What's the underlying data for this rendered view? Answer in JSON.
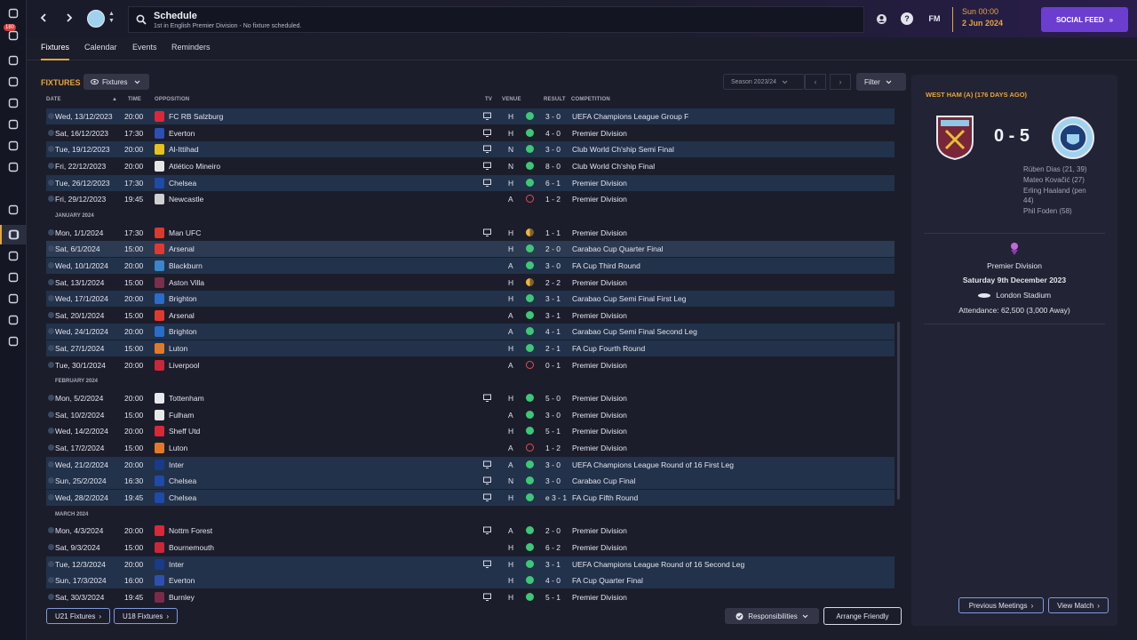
{
  "rail": {
    "badge": "180",
    "items": [
      "home-icon",
      "inbox-icon",
      "squad-icon",
      "tactics-icon",
      "data-hub-icon",
      "staff-icon",
      "dynamics-icon",
      "medical-icon",
      "schedule-icon",
      "competitions-icon",
      "scouting-icon",
      "transfers-icon",
      "club-info-icon",
      "finances-icon",
      "development-icon",
      "exit-icon"
    ]
  },
  "header": {
    "title": "Schedule",
    "subtitle": "1st in English Premier Division - No fixture scheduled.",
    "fm_label": "FM",
    "help_label": "?",
    "time": "Sun 00:00",
    "date": "2 Jun 2024",
    "social_feed": "SOCIAL FEED",
    "social_arrow": "»"
  },
  "tabs": [
    "Fixtures",
    "Calendar",
    "Events",
    "Reminders"
  ],
  "toolbar": {
    "section_label": "FIXTURES",
    "view_dropdown": "Fixtures",
    "season": "Season 2023/24",
    "prev": "‹",
    "next": "›",
    "filter": "Filter"
  },
  "columns": {
    "date": "DATE",
    "time": "TIME",
    "opposition": "OPPOSITION",
    "tv": "TV",
    "venue": "VENUE",
    "result": "RESULT",
    "competition": "COMPETITION"
  },
  "rows": [
    {
      "type": "fixture",
      "date": "Wed, 13/12/2023",
      "time": "20:00",
      "opp": "FC RB Salzburg",
      "crest": "#d9283a",
      "tv": true,
      "venue": "H",
      "res": "W",
      "score": "3 - 0",
      "comp": "UEFA Champions League Group F",
      "style": "alt"
    },
    {
      "type": "fixture",
      "date": "Sat, 16/12/2023",
      "time": "17:30",
      "opp": "Everton",
      "crest": "#2c4fb0",
      "tv": true,
      "venue": "H",
      "res": "W",
      "score": "4 - 0",
      "comp": "Premier Division",
      "style": "norm"
    },
    {
      "type": "fixture",
      "date": "Tue, 19/12/2023",
      "time": "20:00",
      "opp": "Al-Ittihad",
      "crest": "#e8c21c",
      "tv": true,
      "venue": "N",
      "res": "W",
      "score": "3 - 0",
      "comp": "Club World Ch'ship Semi Final",
      "style": "alt"
    },
    {
      "type": "fixture",
      "date": "Fri, 22/12/2023",
      "time": "20:00",
      "opp": "Atlético Mineiro",
      "crest": "#e6e6e6",
      "tv": true,
      "venue": "N",
      "res": "W",
      "score": "8 - 0",
      "comp": "Club World Ch'ship Final",
      "style": "norm"
    },
    {
      "type": "fixture",
      "date": "Tue, 26/12/2023",
      "time": "17:30",
      "opp": "Chelsea",
      "crest": "#1f4aa8",
      "tv": true,
      "venue": "H",
      "res": "W",
      "score": "6 - 1",
      "comp": "Premier Division",
      "style": "alt"
    },
    {
      "type": "fixture",
      "date": "Fri, 29/12/2023",
      "time": "19:45",
      "opp": "Newcastle",
      "crest": "#d0d0d0",
      "tv": false,
      "venue": "A",
      "res": "L",
      "score": "1 - 2",
      "comp": "Premier Division",
      "style": "norm"
    },
    {
      "type": "month",
      "label": "JANUARY 2024"
    },
    {
      "type": "fixture",
      "date": "Mon, 1/1/2024",
      "time": "17:30",
      "opp": "Man UFC",
      "crest": "#d83a2c",
      "tv": true,
      "venue": "H",
      "res": "D",
      "score": "1 - 1",
      "comp": "Premier Division",
      "style": "norm"
    },
    {
      "type": "fixture",
      "date": "Sat, 6/1/2024",
      "time": "15:00",
      "opp": "Arsenal",
      "crest": "#e03a30",
      "tv": false,
      "venue": "H",
      "res": "W",
      "score": "2 - 0",
      "comp": "Carabao Cup Quarter Final",
      "style": "hl"
    },
    {
      "type": "fixture",
      "date": "Wed, 10/1/2024",
      "time": "20:00",
      "opp": "Blackburn",
      "crest": "#3a86c8",
      "tv": false,
      "venue": "A",
      "res": "W",
      "score": "3 - 0",
      "comp": "FA Cup Third Round",
      "style": "alt"
    },
    {
      "type": "fixture",
      "date": "Sat, 13/1/2024",
      "time": "15:00",
      "opp": "Aston Villa",
      "crest": "#7a2f4a",
      "tv": false,
      "venue": "H",
      "res": "D",
      "score": "2 - 2",
      "comp": "Premier Division",
      "style": "norm"
    },
    {
      "type": "fixture",
      "date": "Wed, 17/1/2024",
      "time": "20:00",
      "opp": "Brighton",
      "crest": "#2a6cc8",
      "tv": false,
      "venue": "H",
      "res": "W",
      "score": "3 - 1",
      "comp": "Carabao Cup Semi Final First Leg",
      "style": "alt"
    },
    {
      "type": "fixture",
      "date": "Sat, 20/1/2024",
      "time": "15:00",
      "opp": "Arsenal",
      "crest": "#e03a30",
      "tv": false,
      "venue": "A",
      "res": "W",
      "score": "3 - 1",
      "comp": "Premier Division",
      "style": "norm"
    },
    {
      "type": "fixture",
      "date": "Wed, 24/1/2024",
      "time": "20:00",
      "opp": "Brighton",
      "crest": "#2a6cc8",
      "tv": false,
      "venue": "A",
      "res": "W",
      "score": "4 - 1",
      "comp": "Carabao Cup Semi Final Second Leg",
      "style": "alt"
    },
    {
      "type": "fixture",
      "date": "Sat, 27/1/2024",
      "time": "15:00",
      "opp": "Luton",
      "crest": "#e07a2a",
      "tv": false,
      "venue": "H",
      "res": "W",
      "score": "2 - 1",
      "comp": "FA Cup Fourth Round",
      "style": "alt"
    },
    {
      "type": "fixture",
      "date": "Tue, 30/1/2024",
      "time": "20:00",
      "opp": "Liverpool",
      "crest": "#c8283a",
      "tv": false,
      "venue": "A",
      "res": "L",
      "score": "0 - 1",
      "comp": "Premier Division",
      "style": "norm"
    },
    {
      "type": "month",
      "label": "FEBRUARY 2024"
    },
    {
      "type": "fixture",
      "date": "Mon, 5/2/2024",
      "time": "20:00",
      "opp": "Tottenham",
      "crest": "#e8e8f0",
      "tv": true,
      "venue": "H",
      "res": "W",
      "score": "5 - 0",
      "comp": "Premier Division",
      "style": "norm"
    },
    {
      "type": "fixture",
      "date": "Sat, 10/2/2024",
      "time": "15:00",
      "opp": "Fulham",
      "crest": "#e8e8e8",
      "tv": false,
      "venue": "A",
      "res": "W",
      "score": "3 - 0",
      "comp": "Premier Division",
      "style": "norm"
    },
    {
      "type": "fixture",
      "date": "Wed, 14/2/2024",
      "time": "20:00",
      "opp": "Sheff Utd",
      "crest": "#d8283a",
      "tv": false,
      "venue": "H",
      "res": "W",
      "score": "5 - 1",
      "comp": "Premier Division",
      "style": "norm"
    },
    {
      "type": "fixture",
      "date": "Sat, 17/2/2024",
      "time": "15:00",
      "opp": "Luton",
      "crest": "#e07a2a",
      "tv": false,
      "venue": "A",
      "res": "L",
      "score": "1 - 2",
      "comp": "Premier Division",
      "style": "norm"
    },
    {
      "type": "fixture",
      "date": "Wed, 21/2/2024",
      "time": "20:00",
      "opp": "Inter",
      "crest": "#1a3a8a",
      "tv": true,
      "venue": "A",
      "res": "W",
      "score": "3 - 0",
      "comp": "UEFA Champions League Round of 16 First Leg",
      "style": "alt"
    },
    {
      "type": "fixture",
      "date": "Sun, 25/2/2024",
      "time": "16:30",
      "opp": "Chelsea",
      "crest": "#1f4aa8",
      "tv": true,
      "venue": "N",
      "res": "W",
      "score": "3 - 0",
      "comp": "Carabao Cup Final",
      "style": "alt"
    },
    {
      "type": "fixture",
      "date": "Wed, 28/2/2024",
      "time": "19:45",
      "opp": "Chelsea",
      "crest": "#1f4aa8",
      "tv": true,
      "venue": "H",
      "res": "W",
      "score": "e 3 - 1",
      "comp": "FA Cup Fifth Round",
      "style": "alt"
    },
    {
      "type": "month",
      "label": "MARCH 2024"
    },
    {
      "type": "fixture",
      "date": "Mon, 4/3/2024",
      "time": "20:00",
      "opp": "Nottm Forest",
      "crest": "#d8283a",
      "tv": true,
      "venue": "A",
      "res": "W",
      "score": "2 - 0",
      "comp": "Premier Division",
      "style": "norm"
    },
    {
      "type": "fixture",
      "date": "Sat, 9/3/2024",
      "time": "15:00",
      "opp": "Bournemouth",
      "crest": "#c8283a",
      "tv": false,
      "venue": "H",
      "res": "W",
      "score": "6 - 2",
      "comp": "Premier Division",
      "style": "norm"
    },
    {
      "type": "fixture",
      "date": "Tue, 12/3/2024",
      "time": "20:00",
      "opp": "Inter",
      "crest": "#1a3a8a",
      "tv": true,
      "venue": "H",
      "res": "W",
      "score": "3 - 1",
      "comp": "UEFA Champions League Round of 16 Second Leg",
      "style": "alt"
    },
    {
      "type": "fixture",
      "date": "Sun, 17/3/2024",
      "time": "16:00",
      "opp": "Everton",
      "crest": "#2c4fb0",
      "tv": false,
      "venue": "H",
      "res": "W",
      "score": "4 - 0",
      "comp": "FA Cup Quarter Final",
      "style": "alt"
    },
    {
      "type": "fixture",
      "date": "Sat, 30/3/2024",
      "time": "19:45",
      "opp": "Burnley",
      "crest": "#7a2a4a",
      "tv": true,
      "venue": "H",
      "res": "W",
      "score": "5 - 1",
      "comp": "Premier Division",
      "style": "norm"
    }
  ],
  "footer": {
    "u21": "U21 Fixtures",
    "u18": "U18 Fixtures",
    "responsibilities": "Responsibilities",
    "arrange": "Arrange Friendly"
  },
  "side": {
    "title": "WEST HAM (A) (176 DAYS AGO)",
    "score": "0 - 5",
    "scorers": [
      "Rúben Dias (21, 39)",
      "Mateo Kovačić (27)",
      "Erling Haaland (pen",
      "44)",
      "Phil Foden (58)"
    ],
    "competition": "Premier Division",
    "match_date": "Saturday 9th December 2023",
    "stadium": "London Stadium",
    "attendance": "Attendance: 62,500 (3,000 Away)",
    "prev_meetings": "Previous Meetings",
    "view_match": "View Match"
  }
}
